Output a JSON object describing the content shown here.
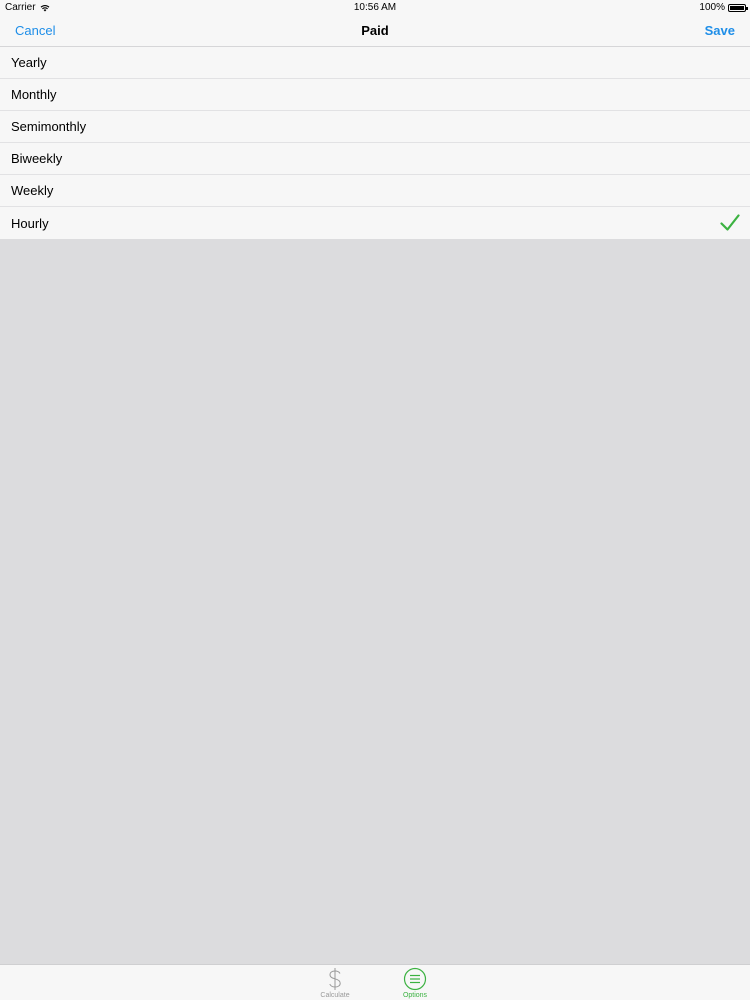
{
  "status_bar": {
    "carrier": "Carrier",
    "time": "10:56 AM",
    "battery": "100%"
  },
  "nav": {
    "cancel": "Cancel",
    "title": "Paid",
    "save": "Save"
  },
  "options": [
    {
      "label": "Yearly",
      "selected": false
    },
    {
      "label": "Monthly",
      "selected": false
    },
    {
      "label": "Semimonthly",
      "selected": false
    },
    {
      "label": "Biweekly",
      "selected": false
    },
    {
      "label": "Weekly",
      "selected": false
    },
    {
      "label": "Hourly",
      "selected": true
    }
  ],
  "tabs": [
    {
      "label": "Calculate",
      "icon": "dollar-icon",
      "active": false
    },
    {
      "label": "Options",
      "icon": "list-icon",
      "active": true
    }
  ],
  "colors": {
    "accent_blue": "#1e8ee8",
    "accent_green": "#3bb241",
    "background": "#dcdcde"
  }
}
